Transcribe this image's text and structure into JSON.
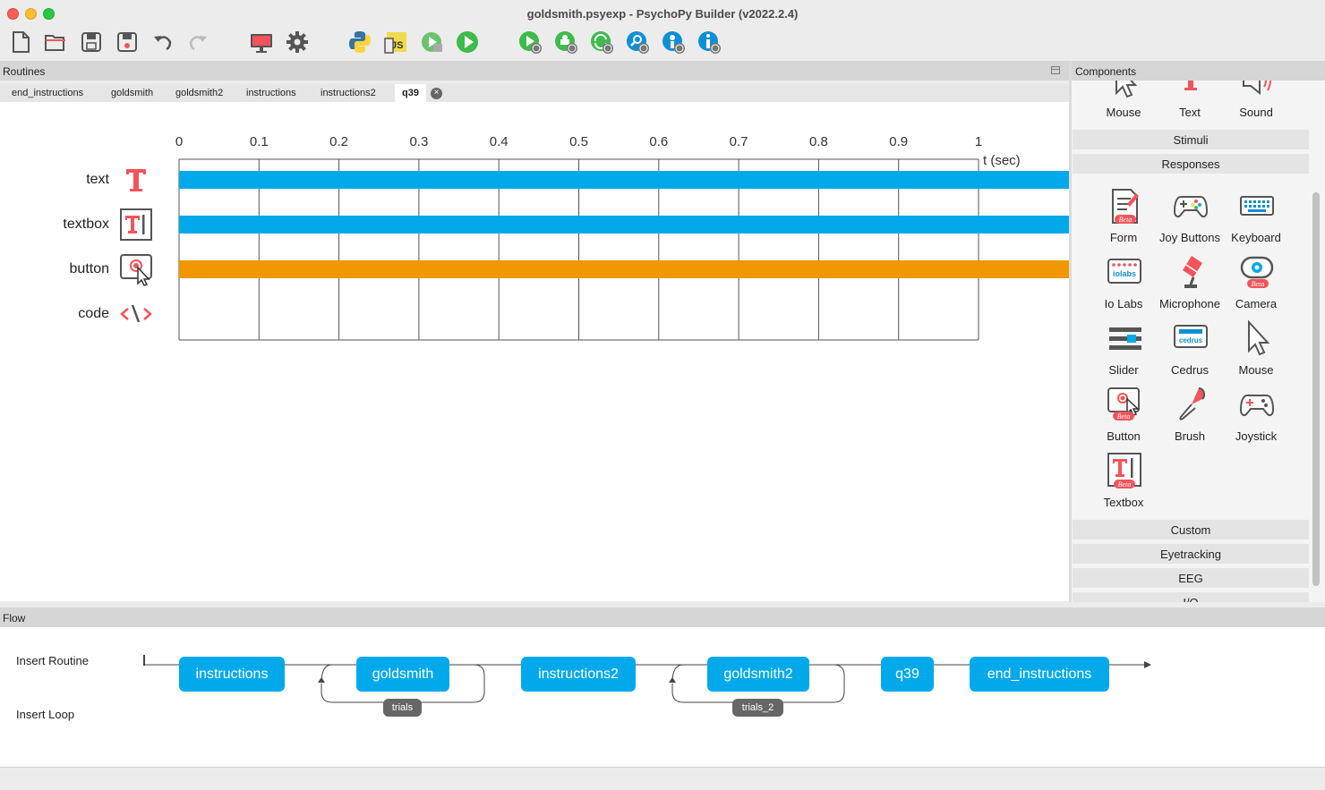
{
  "window": {
    "title": "goldsmith.psyexp - PsychoPy Builder (v2022.2.4)"
  },
  "toolbar": {
    "buttons": [
      "new-file",
      "open-file",
      "save-file",
      "save-as",
      "undo",
      "redo",
      "monitor-center",
      "experiment-settings",
      "compile-python",
      "compile-js",
      "run-runner",
      "run",
      "pilot-online",
      "sync-project",
      "project-online",
      "search-project",
      "user-info",
      "about-info"
    ]
  },
  "routines": {
    "header": "Routines",
    "tabs": [
      "end_instructions",
      "goldsmith",
      "goldsmith2",
      "instructions",
      "instructions2",
      "q39"
    ],
    "active_tab": "q39",
    "timeline": {
      "ticks": [
        "0",
        "0.1",
        "0.2",
        "0.3",
        "0.4",
        "0.5",
        "0.6",
        "0.7",
        "0.8",
        "0.9",
        "1"
      ],
      "axis_label": "t (sec)",
      "components": [
        {
          "name": "text",
          "icon": "text-icon",
          "bar_color": "#02a9ea",
          "has_bar": true
        },
        {
          "name": "textbox",
          "icon": "textbox-icon",
          "bar_color": "#02a9ea",
          "has_bar": true
        },
        {
          "name": "button",
          "icon": "button-icon",
          "bar_color": "#f09804",
          "has_bar": true
        },
        {
          "name": "code",
          "icon": "code-icon",
          "bar_color": "",
          "has_bar": false
        }
      ]
    }
  },
  "components": {
    "header": "Components",
    "top_row": [
      "Mouse",
      "Text",
      "Sound"
    ],
    "categories": {
      "stimuli": "Stimuli",
      "responses": "Responses",
      "custom": "Custom",
      "eyetracking": "Eyetracking",
      "eeg": "EEG",
      "io": "I/O"
    },
    "responses": [
      "Form",
      "Joy Buttons",
      "Keyboard",
      "Io Labs",
      "Microphone",
      "Camera",
      "Slider",
      "Cedrus",
      "Mouse",
      "Button",
      "Brush",
      "Joystick",
      "Textbox"
    ],
    "beta_badge": "Beta",
    "iolabs_text": "iolabs",
    "cedrus_text": "cedrus"
  },
  "flow": {
    "header": "Flow",
    "insert_routine": "Insert Routine",
    "insert_loop": "Insert Loop",
    "routines": [
      "instructions",
      "goldsmith",
      "instructions2",
      "goldsmith2",
      "q39",
      "end_instructions"
    ],
    "loops": [
      "trials",
      "trials_2"
    ]
  },
  "colors": {
    "routine_blue": "#02a9ea",
    "component_orange": "#f09804",
    "psychopy_red": "#f2545b"
  }
}
